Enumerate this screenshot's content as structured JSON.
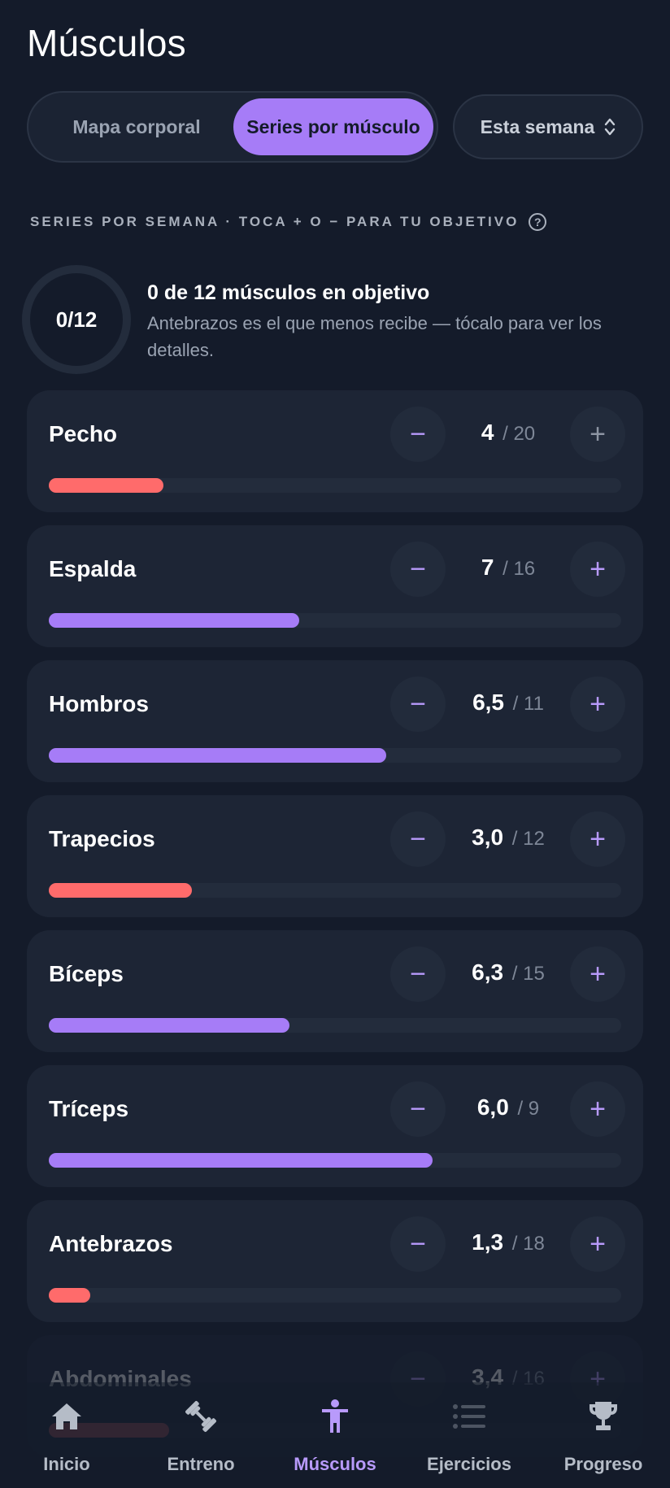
{
  "header": {
    "title": "Músculos"
  },
  "view_toggle": {
    "options": [
      {
        "label": "Mapa corporal",
        "active": false
      },
      {
        "label": "Series por músculo",
        "active": true
      }
    ]
  },
  "period_select": {
    "label": "Esta semana"
  },
  "section": {
    "label": "SERIES POR SEMANA · TOCA + O − PARA TU OBJETIVO",
    "help": "?"
  },
  "summary": {
    "ring_text": "0/12",
    "title": "0 de 12 músculos en objetivo",
    "subtitle": "Antebrazos es el que menos recibe — tócalo para ver los detalles."
  },
  "muscles": [
    {
      "name": "Pecho",
      "current": "4",
      "target": "20",
      "progress": 0.2,
      "status": "low"
    },
    {
      "name": "Espalda",
      "current": "7",
      "target": "16",
      "progress": 0.4375,
      "status": "ok"
    },
    {
      "name": "Hombros",
      "current": "6,5",
      "target": "11",
      "progress": 0.59,
      "status": "ok"
    },
    {
      "name": "Trapecios",
      "current": "3,0",
      "target": "12",
      "progress": 0.25,
      "status": "low"
    },
    {
      "name": "Bíceps",
      "current": "6,3",
      "target": "15",
      "progress": 0.42,
      "status": "ok"
    },
    {
      "name": "Tríceps",
      "current": "6,0",
      "target": "9",
      "progress": 0.67,
      "status": "ok"
    },
    {
      "name": "Antebrazos",
      "current": "1,3",
      "target": "18",
      "progress": 0.072,
      "status": "low"
    },
    {
      "name": "Abdominales",
      "current": "3,4",
      "target": "16",
      "progress": 0.21,
      "status": "low"
    }
  ],
  "controls": {
    "minus": "−",
    "plus": "+",
    "separator": "/"
  },
  "colors": {
    "accent": "#a67cf7",
    "low": "#ff6b6b",
    "ok": "#a67cf7",
    "background": "#141b2a",
    "card": "#1d2535"
  },
  "nav": {
    "items": [
      {
        "label": "Inicio",
        "icon": "home-icon",
        "active": false
      },
      {
        "label": "Entreno",
        "icon": "dumbbell-icon",
        "active": false
      },
      {
        "label": "Músculos",
        "icon": "body-icon",
        "active": true
      },
      {
        "label": "Ejercicios",
        "icon": "list-icon",
        "active": false
      },
      {
        "label": "Progreso",
        "icon": "trophy-icon",
        "active": false
      }
    ]
  }
}
